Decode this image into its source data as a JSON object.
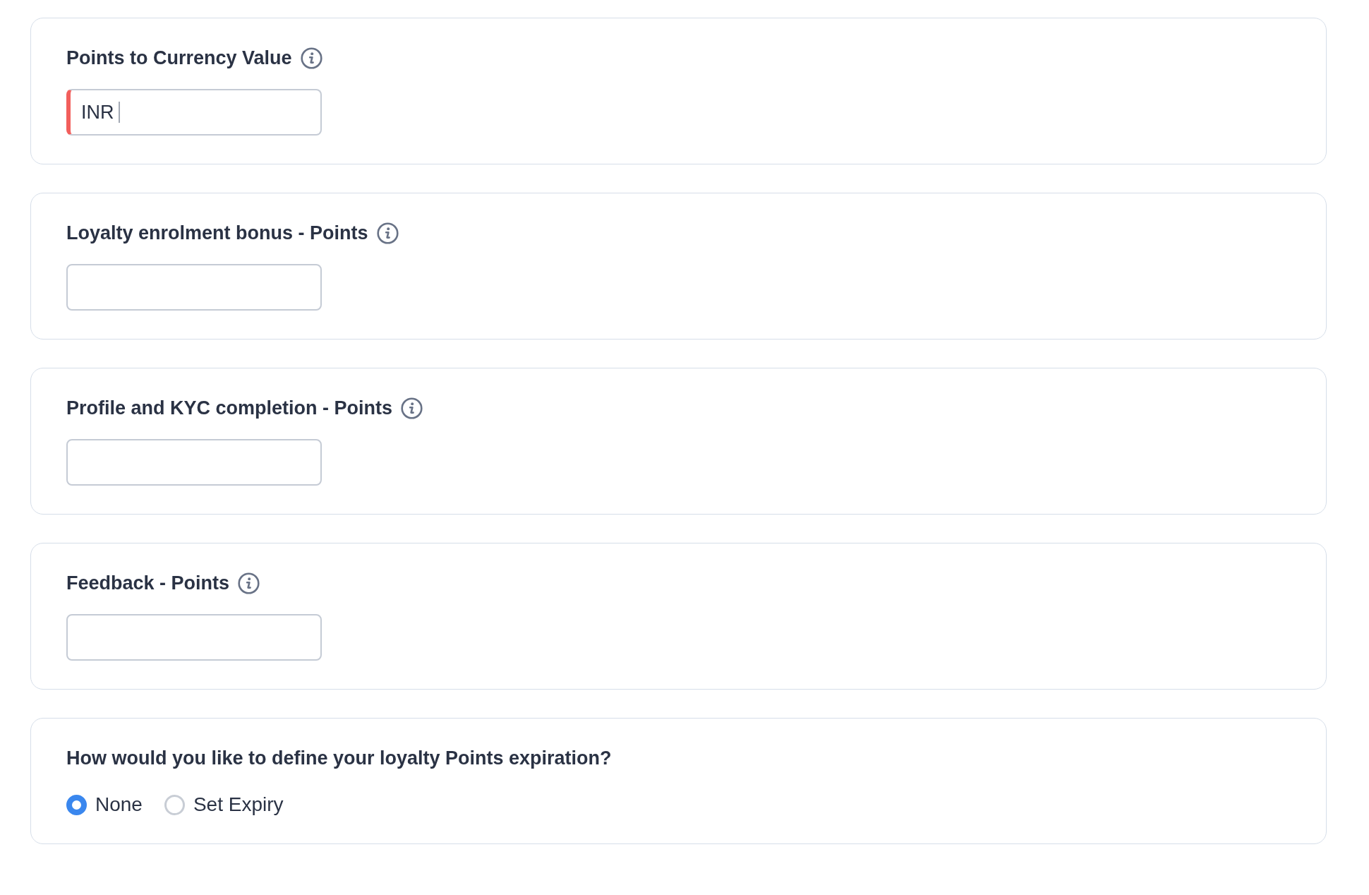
{
  "fields": [
    {
      "label": "Points to Currency Value",
      "value": "INR",
      "error": true,
      "focused": true
    },
    {
      "label": "Loyalty enrolment bonus - Points",
      "error": false,
      "focused": false
    },
    {
      "label": "Profile and KYC completion - Points",
      "error": false,
      "focused": false
    },
    {
      "label": "Feedback - Points",
      "error": false,
      "focused": false
    }
  ],
  "expiration": {
    "question": "How would you like to define your loyalty Points expiration?",
    "options": [
      {
        "label": "None",
        "selected": true
      },
      {
        "label": "Set Expiry",
        "selected": false
      }
    ]
  }
}
